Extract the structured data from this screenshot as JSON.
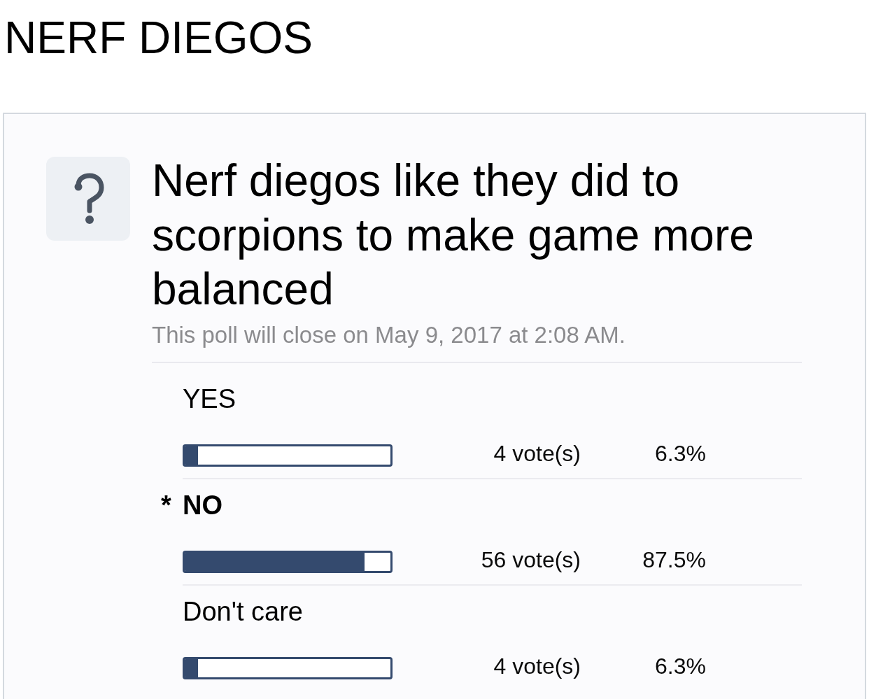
{
  "page": {
    "title": "NERF DIEGOS"
  },
  "poll": {
    "question": "Nerf diegos like they did to scorpions to make game more balanced",
    "closing_note": "This poll will close on May 9, 2017 at 2:08 AM.",
    "vote_marker": "*",
    "options": [
      {
        "label": "YES",
        "selected": false,
        "level": 0.063,
        "votes": "4 vote(s)",
        "percent": "6.3%"
      },
      {
        "label": "NO",
        "selected": true,
        "level": 0.875,
        "votes": "56 vote(s)",
        "percent": "87.5%"
      },
      {
        "label": "Don't care",
        "selected": false,
        "level": 0.063,
        "votes": "4 vote(s)",
        "percent": "6.3%"
      }
    ]
  }
}
